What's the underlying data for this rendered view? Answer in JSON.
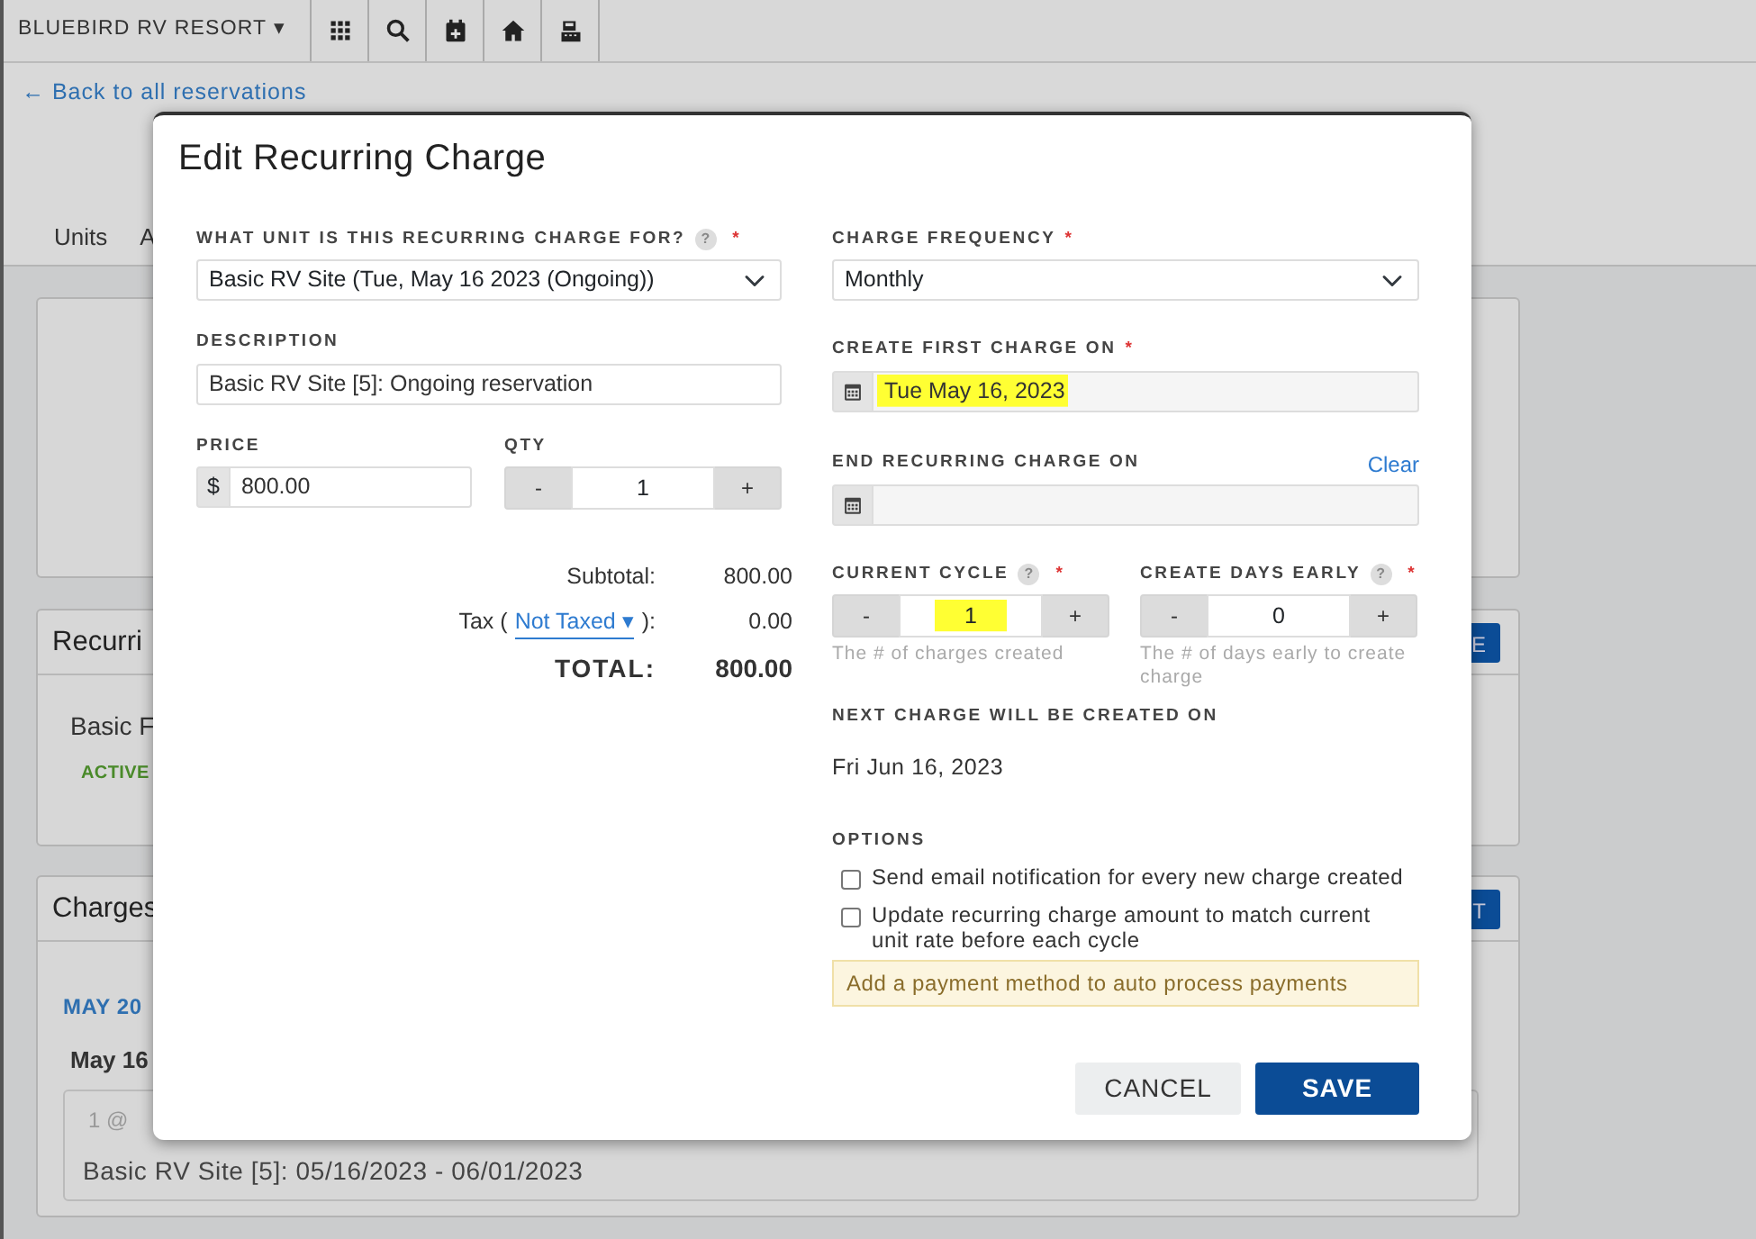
{
  "navbar": {
    "brand": "BLUEBIRD RV RESORT",
    "caret": "▾"
  },
  "back_link": {
    "arrow": "←",
    "label": "Back to all reservations"
  },
  "tabs": [
    {
      "label": "Units",
      "selected": false
    },
    {
      "label": "A",
      "selected": false
    }
  ],
  "recurring_card": {
    "title": "Recurri",
    "button": "E",
    "name": "Basic F",
    "status": "ACTIVE"
  },
  "charges_card": {
    "title": "Charges",
    "button": "T",
    "month": "MAY 20",
    "day": "May 16",
    "entry_qty": "1 @",
    "entry_description": "Basic RV Site [5]: 05/16/2023 - 06/01/2023"
  },
  "modal": {
    "title": "Edit Recurring Charge",
    "unit": {
      "label": "WHAT UNIT IS THIS RECURRING CHARGE FOR?",
      "help": "?",
      "required_mark": "*",
      "value": "Basic RV Site (Tue, May 16 2023 (Ongoing))"
    },
    "description": {
      "label": "DESCRIPTION",
      "value": "Basic RV Site [5]: Ongoing reservation"
    },
    "price": {
      "label": "PRICE",
      "prefix": "$",
      "value": "800.00"
    },
    "qty": {
      "label": "QTY",
      "minus": "-",
      "value": "1",
      "plus": "+"
    },
    "totals": {
      "subtotal_label": "Subtotal:",
      "subtotal": "800.00",
      "tax_open": "Tax (",
      "tax_option": "Not Taxed",
      "tax_caret": "▾",
      "tax_close": "):",
      "tax": "0.00",
      "total_label": "TOTAL:",
      "total": "800.00"
    },
    "frequency": {
      "label": "CHARGE FREQUENCY",
      "required_mark": "*",
      "value": "Monthly"
    },
    "first_charge": {
      "label": "CREATE FIRST CHARGE ON",
      "required_mark": "*",
      "value": "Tue May 16, 2023",
      "highlighted": true
    },
    "end_charge": {
      "label": "END RECURRING CHARGE ON",
      "clear": "Clear"
    },
    "current_cycle": {
      "label": "CURRENT CYCLE",
      "help": "?",
      "required_mark": "*",
      "minus": "-",
      "value": "1",
      "plus": "+",
      "hint": "The # of charges created",
      "highlighted": true
    },
    "days_early": {
      "label": "CREATE DAYS EARLY",
      "help": "?",
      "required_mark": "*",
      "minus": "-",
      "value": "0",
      "plus": "+",
      "hint": "The # of days early to create charge",
      "highlighted": false
    },
    "next_charge": {
      "label": "NEXT CHARGE WILL BE CREATED ON",
      "value": "Fri Jun 16, 2023"
    },
    "options": {
      "label": "OPTIONS",
      "items": [
        {
          "label": "Send email notification for every new charge created",
          "checked": false
        },
        {
          "label": "Update recurring charge amount to match current unit rate before each cycle",
          "checked": false
        }
      ]
    },
    "notice": "Add a payment method to auto process payments",
    "cancel": "CANCEL",
    "save": "SAVE"
  }
}
